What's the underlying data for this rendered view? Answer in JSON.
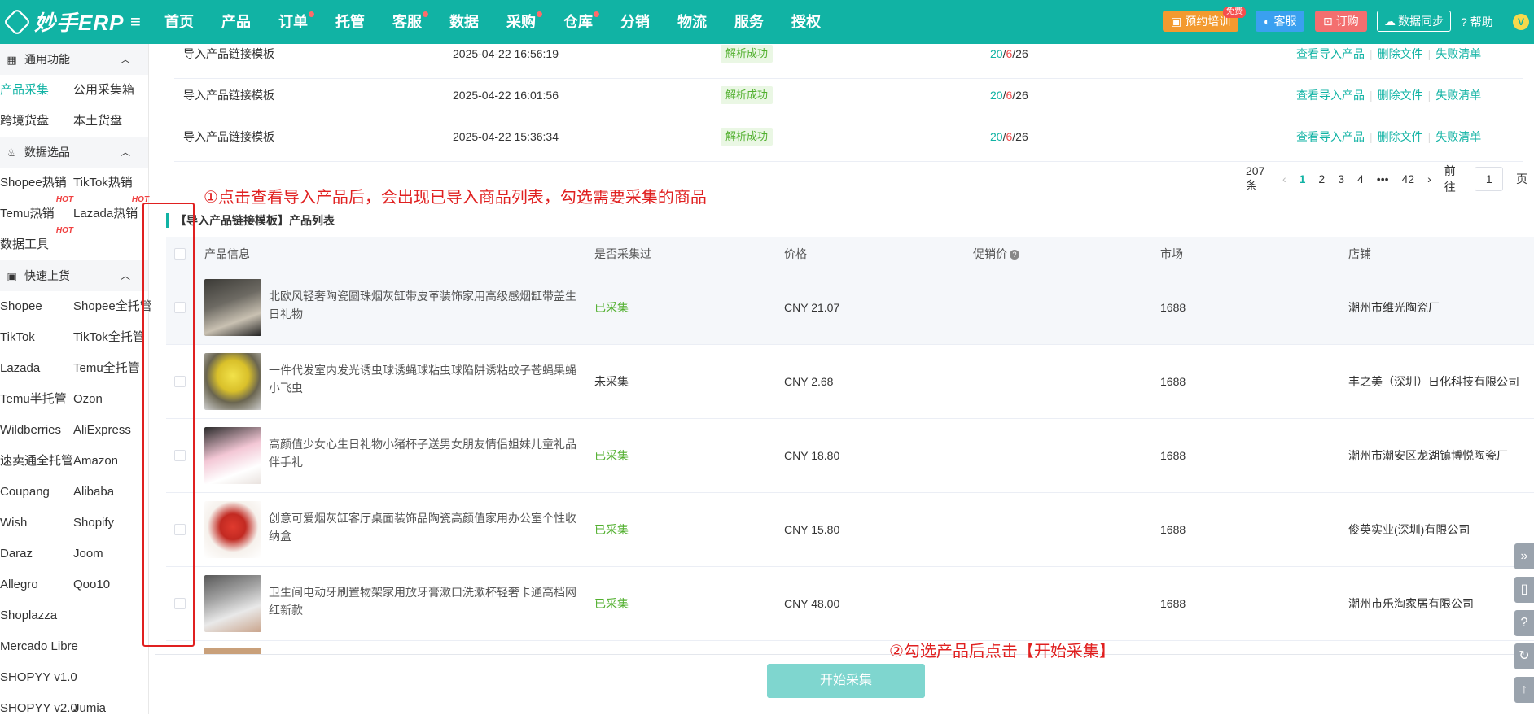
{
  "header": {
    "logo_text": "妙手ERP",
    "nav": [
      {
        "label": "首页",
        "dot": false
      },
      {
        "label": "产品",
        "dot": false
      },
      {
        "label": "订单",
        "dot": true
      },
      {
        "label": "托管",
        "dot": false
      },
      {
        "label": "客服",
        "dot": true
      },
      {
        "label": "数据",
        "dot": false
      },
      {
        "label": "采购",
        "dot": true
      },
      {
        "label": "仓库",
        "dot": true
      },
      {
        "label": "分销",
        "dot": false
      },
      {
        "label": "物流",
        "dot": false
      },
      {
        "label": "服务",
        "dot": false
      },
      {
        "label": "授权",
        "dot": false
      }
    ],
    "training_label": "预约培训",
    "free_badge": "免费",
    "cs_label": "客服",
    "order_label": "订购",
    "sync_label": "数据同步",
    "help_label": "帮助",
    "avatar_letter": "V"
  },
  "sidebar": {
    "sections": [
      {
        "title": "通用功能",
        "icon": "grid-icon",
        "items": [
          {
            "label": "产品采集",
            "active": true
          },
          {
            "label": "公用采集箱"
          },
          {
            "label": "跨境货盘"
          },
          {
            "label": "本土货盘"
          }
        ]
      },
      {
        "title": "数据选品",
        "icon": "fire-icon",
        "items": [
          {
            "label": "Shopee热销"
          },
          {
            "label": "TikTok热销"
          },
          {
            "label": "Temu热销",
            "hot": "HOT"
          },
          {
            "label": "Lazada热销",
            "hot": "HOT"
          },
          {
            "label": "数据工具",
            "hot": "HOT"
          }
        ]
      },
      {
        "title": "快速上货",
        "icon": "bag-icon",
        "items": [
          {
            "label": "Shopee"
          },
          {
            "label": "Shopee全托管"
          },
          {
            "label": "TikTok"
          },
          {
            "label": "TikTok全托管"
          },
          {
            "label": "Lazada"
          },
          {
            "label": "Temu全托管"
          },
          {
            "label": "Temu半托管"
          },
          {
            "label": "Ozon"
          },
          {
            "label": "Wildberries"
          },
          {
            "label": "AliExpress"
          },
          {
            "label": "速卖通全托管"
          },
          {
            "label": "Amazon"
          },
          {
            "label": "Coupang"
          },
          {
            "label": "Alibaba"
          },
          {
            "label": "Wish"
          },
          {
            "label": "Shopify"
          },
          {
            "label": "Daraz"
          },
          {
            "label": "Joom"
          },
          {
            "label": "Allegro"
          },
          {
            "label": "Qoo10"
          },
          {
            "label": "Shoplazza"
          },
          {
            "label": ""
          },
          {
            "label": "Mercado Libre"
          },
          {
            "label": ""
          },
          {
            "label": "SHOPYY v1.0"
          },
          {
            "label": ""
          },
          {
            "label": "SHOPYY v2.0"
          },
          {
            "label": "Jumia"
          }
        ]
      }
    ]
  },
  "imports": {
    "rows": [
      {
        "name": "导入产品链接模板",
        "time": "2025-04-22 16:56:19",
        "status": "解析成功",
        "ok": "20",
        "fail": "6",
        "total": "26"
      },
      {
        "name": "导入产品链接模板",
        "time": "2025-04-22 16:01:56",
        "status": "解析成功",
        "ok": "20",
        "fail": "6",
        "total": "26"
      },
      {
        "name": "导入产品链接模板",
        "time": "2025-04-22 15:36:34",
        "status": "解析成功",
        "ok": "20",
        "fail": "6",
        "total": "26"
      }
    ],
    "actions": [
      "查看导入产品",
      "删除文件",
      "失败清单"
    ],
    "pager": {
      "total": "207条",
      "pages": [
        "1",
        "2",
        "3",
        "4",
        "•••",
        "42"
      ],
      "goto_label": "前往",
      "page_value": "1",
      "page_suffix": "页"
    }
  },
  "annotations": {
    "step1": "①点击查看导入产品后，会出现已导入商品列表，勾选需要采集的商品",
    "step2": "②勾选产品后点击【开始采集】"
  },
  "products": {
    "title": "【导入产品链接模板】产品列表",
    "columns": [
      "产品信息",
      "是否采集过",
      "价格",
      "促销价",
      "市场",
      "店铺"
    ],
    "rows": [
      {
        "name": "北欧风轻奢陶瓷圆珠烟灰缸带皮革装饰家用高级感烟缸带盖生日礼物",
        "collected": "已采集",
        "is_collected": true,
        "price": "CNY 21.07",
        "market": "1688",
        "shop": "潮州市维光陶瓷厂"
      },
      {
        "name": "一件代发室内发光诱虫球诱蝇球粘虫球陷阱诱粘蚊子苍蝇果蝇小飞虫",
        "collected": "未采集",
        "is_collected": false,
        "price": "CNY 2.68",
        "market": "1688",
        "shop": "丰之美（深圳）日化科技有限公司"
      },
      {
        "name": "高颜值少女心生日礼物小猪杯子送男女朋友情侣姐妹儿童礼品伴手礼",
        "collected": "已采集",
        "is_collected": true,
        "price": "CNY 18.80",
        "market": "1688",
        "shop": "潮州市潮安区龙湖镇博悦陶瓷厂"
      },
      {
        "name": "创意可爱烟灰缸客厅桌面装饰品陶瓷高颜值家用办公室个性收纳盒",
        "collected": "已采集",
        "is_collected": true,
        "price": "CNY 15.80",
        "market": "1688",
        "shop": "俊英实业(深圳)有限公司"
      },
      {
        "name": "卫生间电动牙刷置物架家用放牙膏漱口洗漱杯轻奢卡通高档网红新款",
        "collected": "已采集",
        "is_collected": true,
        "price": "CNY 48.00",
        "market": "1688",
        "shop": "潮州市乐淘家居有限公司"
      }
    ],
    "start_label": "开始采集"
  },
  "colors": {
    "brand": "#11b3a4",
    "annotation": "#e02020",
    "collected": "#52b02f"
  }
}
